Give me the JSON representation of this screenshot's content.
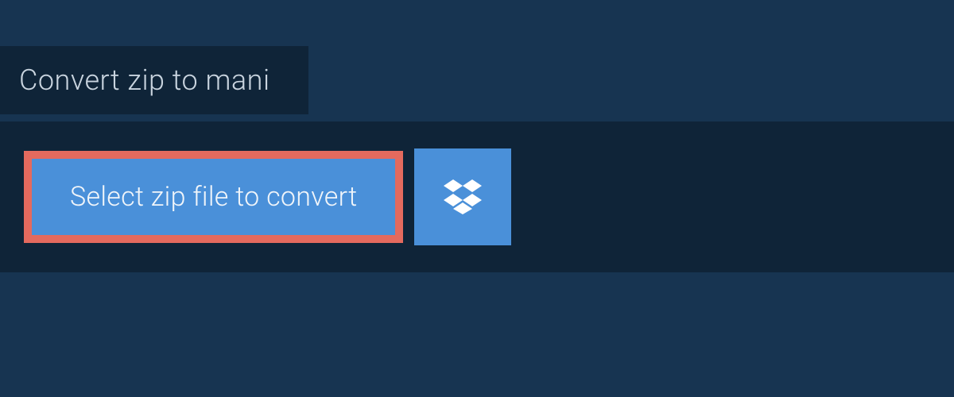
{
  "page": {
    "title": "Convert zip to mani"
  },
  "upload": {
    "select_button_label": "Select zip file to convert",
    "dropbox_icon": "dropbox"
  },
  "colors": {
    "background": "#173451",
    "panel": "#0f2438",
    "button_primary": "#4a90d9",
    "button_highlight_border": "#e46a5e",
    "text_light": "#c9d4df"
  }
}
